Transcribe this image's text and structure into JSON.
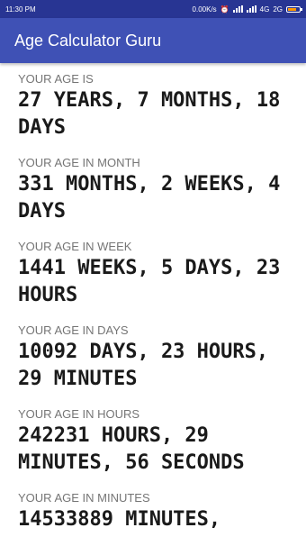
{
  "status_bar": {
    "time": "11:30 PM",
    "speed": "0.00K/s",
    "network": "4G",
    "sim": "2G"
  },
  "app_bar": {
    "title": "Age Calculator Guru"
  },
  "sections": [
    {
      "label": "YOUR AGE IS",
      "value": "27 YEARS, 7 MONTHS, 18 DAYS"
    },
    {
      "label": "YOUR AGE IN MONTH",
      "value": "331 MONTHS, 2 WEEKS, 4 DAYS"
    },
    {
      "label": "YOUR AGE IN WEEK",
      "value": "1441 WEEKS, 5 DAYS, 23 HOURS"
    },
    {
      "label": "YOUR AGE IN DAYS",
      "value": "10092 DAYS, 23 HOURS, 29 MINUTES"
    },
    {
      "label": "YOUR AGE IN HOURS",
      "value": "242231 HOURS, 29 MINUTES, 56 SECONDS"
    },
    {
      "label": "YOUR AGE IN MINUTES",
      "value": "14533889 MINUTES,"
    }
  ],
  "colors": {
    "status_bar": "#283593",
    "app_bar": "#3f51b5",
    "label": "#757575",
    "value": "#1a1a1a"
  }
}
